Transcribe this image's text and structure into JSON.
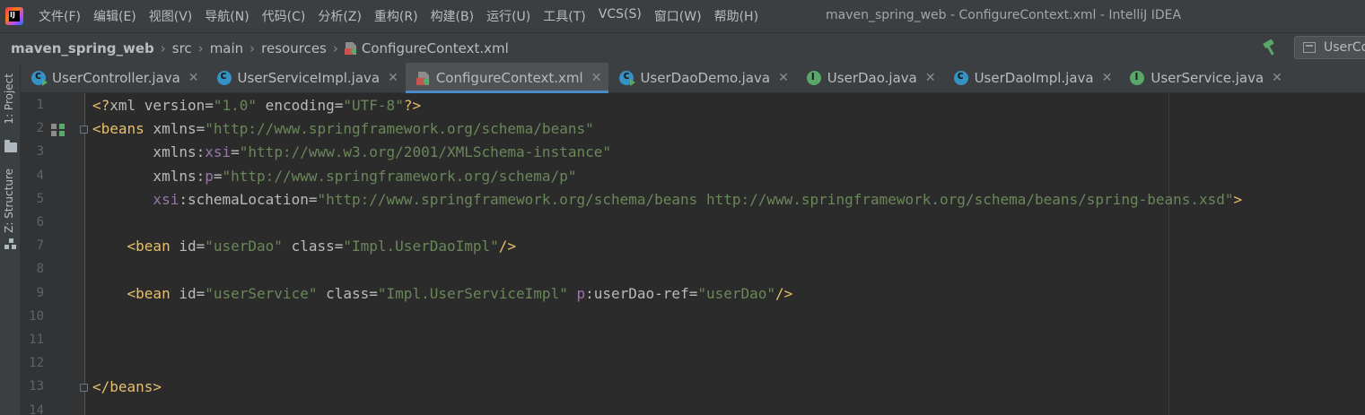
{
  "app": {
    "window_title": "maven_spring_web - ConfigureContext.xml - IntelliJ IDEA",
    "logo_text": "IJ"
  },
  "menu": [
    "文件(F)",
    "编辑(E)",
    "视图(V)",
    "导航(N)",
    "代码(C)",
    "分析(Z)",
    "重构(R)",
    "构建(B)",
    "运行(U)",
    "工具(T)",
    "VCS(S)",
    "窗口(W)",
    "帮助(H)"
  ],
  "breadcrumb": [
    "maven_spring_web",
    "src",
    "main",
    "resources",
    "ConfigureContext.xml"
  ],
  "run_config": {
    "label": "UserCo"
  },
  "tool_windows": {
    "project": "1: Project",
    "structure": "Z: Structure"
  },
  "tabs": [
    {
      "label": "UserController.java",
      "icon": "class-run",
      "active": false
    },
    {
      "label": "UserServiceImpl.java",
      "icon": "class",
      "active": false
    },
    {
      "label": "ConfigureContext.xml",
      "icon": "xml",
      "active": true
    },
    {
      "label": "UserDaoDemo.java",
      "icon": "class-run",
      "active": false
    },
    {
      "label": "UserDao.java",
      "icon": "interface",
      "active": false
    },
    {
      "label": "UserDaoImpl.java",
      "icon": "class",
      "active": false
    },
    {
      "label": "UserService.java",
      "icon": "interface",
      "active": false
    }
  ],
  "tab_close": "✕",
  "editor": {
    "line_numbers": [
      "1",
      "2",
      "3",
      "4",
      "5",
      "6",
      "7",
      "8",
      "9",
      "10",
      "11",
      "12",
      "13",
      "14"
    ],
    "colors": {
      "tag": "#e8bf6a",
      "attribute": "#bababa",
      "value": "#6a8759",
      "namespace": "#9876aa"
    },
    "lines": [
      [
        [
          "b",
          "<?"
        ],
        [
          "a",
          "xml "
        ],
        [
          "a",
          "version"
        ],
        [
          "e",
          "="
        ],
        [
          "v",
          "\"1.0\""
        ],
        [
          "a",
          " encoding"
        ],
        [
          "e",
          "="
        ],
        [
          "v",
          "\"UTF-8\""
        ],
        [
          "b",
          "?>"
        ]
      ],
      [
        [
          "b",
          "<beans "
        ],
        [
          "a",
          "xmlns"
        ],
        [
          "e",
          "="
        ],
        [
          "v",
          "\"http://www.springframework.org/schema/beans\""
        ]
      ],
      [
        [
          "a",
          "       xmlns"
        ],
        [
          "e",
          ":"
        ],
        [
          "n",
          "xsi"
        ],
        [
          "e",
          "="
        ],
        [
          "v",
          "\"http://www.w3.org/2001/XMLSchema-instance\""
        ]
      ],
      [
        [
          "a",
          "       xmlns"
        ],
        [
          "e",
          ":"
        ],
        [
          "n",
          "p"
        ],
        [
          "e",
          "="
        ],
        [
          "v",
          "\"http://www.springframework.org/schema/p\""
        ]
      ],
      [
        [
          "n",
          "       xsi"
        ],
        [
          "e",
          ":"
        ],
        [
          "a",
          "schemaLocation"
        ],
        [
          "e",
          "="
        ],
        [
          "v",
          "\"http://www.springframework.org/schema/beans http://www.springframework.org/schema/beans/spring-beans.xsd\""
        ],
        [
          "b",
          ">"
        ]
      ],
      [],
      [
        [
          "b",
          "    <bean "
        ],
        [
          "a",
          "id"
        ],
        [
          "e",
          "="
        ],
        [
          "v",
          "\"userDao\""
        ],
        [
          "a",
          " class"
        ],
        [
          "e",
          "="
        ],
        [
          "v",
          "\"Impl.UserDaoImpl\""
        ],
        [
          "b",
          "/>"
        ]
      ],
      [],
      [
        [
          "b",
          "    <bean "
        ],
        [
          "a",
          "id"
        ],
        [
          "e",
          "="
        ],
        [
          "v",
          "\"userService\""
        ],
        [
          "a",
          " class"
        ],
        [
          "e",
          "="
        ],
        [
          "v",
          "\"Impl.UserServiceImpl\""
        ],
        [
          "n",
          " p"
        ],
        [
          "e",
          ":"
        ],
        [
          "a",
          "userDao-ref"
        ],
        [
          "e",
          "="
        ],
        [
          "v",
          "\"userDao\""
        ],
        [
          "b",
          "/>"
        ]
      ],
      [],
      [],
      [],
      [
        [
          "b",
          "</beans>"
        ]
      ],
      []
    ]
  }
}
